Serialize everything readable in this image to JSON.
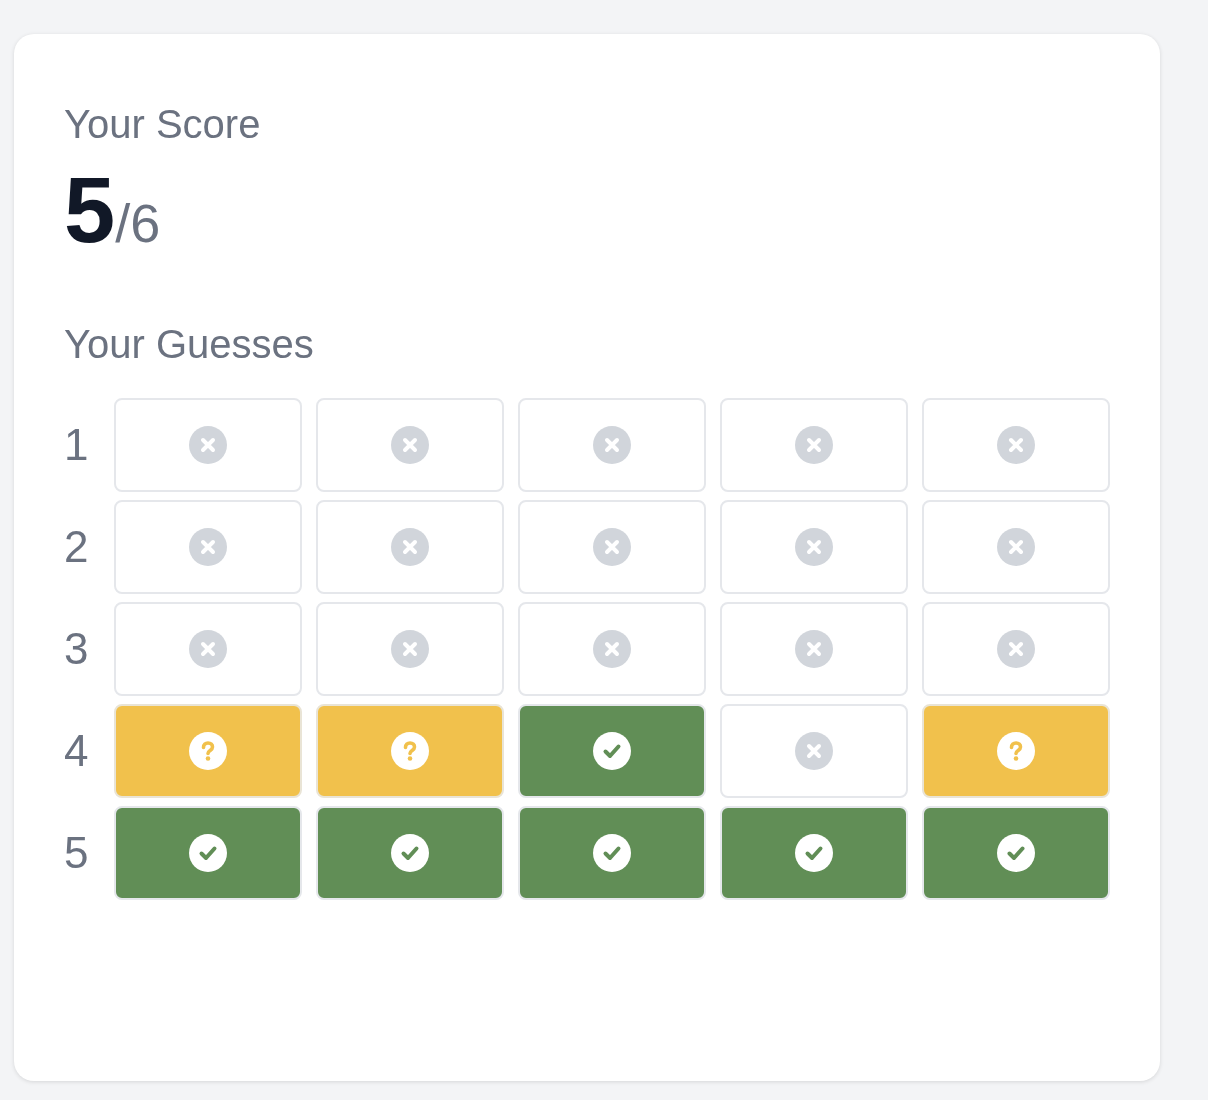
{
  "score": {
    "title": "Your Score",
    "value": "5",
    "total": "/6"
  },
  "guesses": {
    "title": "Your Guesses",
    "rows": [
      {
        "label": "1",
        "tiles": [
          {
            "kind": "absent"
          },
          {
            "kind": "absent"
          },
          {
            "kind": "absent"
          },
          {
            "kind": "absent"
          },
          {
            "kind": "absent"
          }
        ]
      },
      {
        "label": "2",
        "tiles": [
          {
            "kind": "absent"
          },
          {
            "kind": "absent"
          },
          {
            "kind": "absent"
          },
          {
            "kind": "absent"
          },
          {
            "kind": "absent"
          }
        ]
      },
      {
        "label": "3",
        "tiles": [
          {
            "kind": "absent"
          },
          {
            "kind": "absent"
          },
          {
            "kind": "absent"
          },
          {
            "kind": "absent"
          },
          {
            "kind": "absent"
          }
        ]
      },
      {
        "label": "4",
        "tiles": [
          {
            "kind": "present"
          },
          {
            "kind": "present"
          },
          {
            "kind": "correct"
          },
          {
            "kind": "absent"
          },
          {
            "kind": "present"
          }
        ]
      },
      {
        "label": "5",
        "tiles": [
          {
            "kind": "correct"
          },
          {
            "kind": "correct"
          },
          {
            "kind": "correct"
          },
          {
            "kind": "correct"
          },
          {
            "kind": "correct"
          }
        ]
      }
    ]
  }
}
